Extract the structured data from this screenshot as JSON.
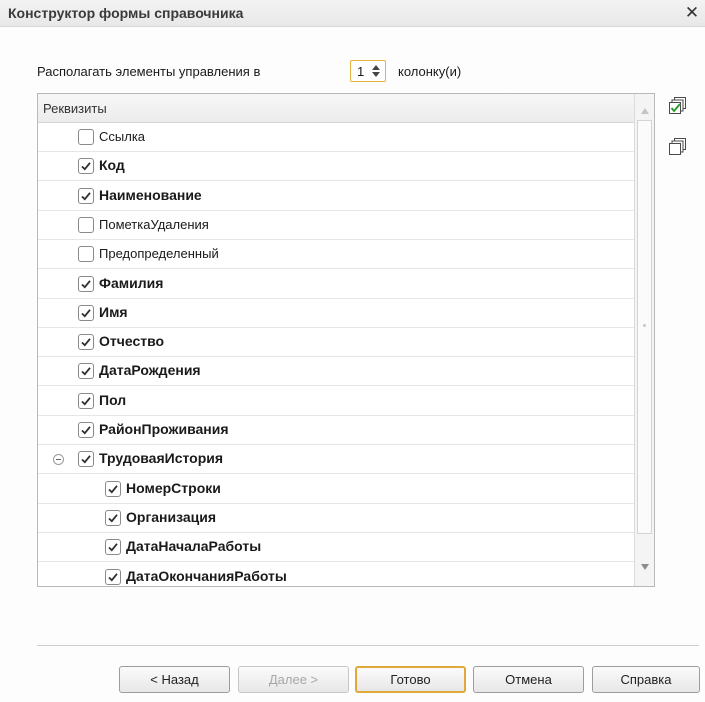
{
  "window": {
    "title": "Конструктор формы справочника",
    "close_glyph": "✕"
  },
  "columns_setting": {
    "label": "Располагать элементы управления в",
    "value": "1",
    "suffix": "колонку(и)"
  },
  "tree": {
    "header": "Реквизиты",
    "rows": [
      {
        "label": "Ссылка",
        "checked": false,
        "bold": false,
        "level": 0
      },
      {
        "label": "Код",
        "checked": true,
        "bold": true,
        "level": 0
      },
      {
        "label": "Наименование",
        "checked": true,
        "bold": true,
        "level": 0
      },
      {
        "label": "ПометкаУдаления",
        "checked": false,
        "bold": false,
        "level": 0
      },
      {
        "label": "Предопределенный",
        "checked": false,
        "bold": false,
        "level": 0
      },
      {
        "label": "Фамилия",
        "checked": true,
        "bold": true,
        "level": 0
      },
      {
        "label": "Имя",
        "checked": true,
        "bold": true,
        "level": 0
      },
      {
        "label": "Отчество",
        "checked": true,
        "bold": true,
        "level": 0
      },
      {
        "label": "ДатаРождения",
        "checked": true,
        "bold": true,
        "level": 0
      },
      {
        "label": "Пол",
        "checked": true,
        "bold": true,
        "level": 0
      },
      {
        "label": "РайонПроживания",
        "checked": true,
        "bold": true,
        "level": 0
      },
      {
        "label": "ТрудоваяИстория",
        "checked": true,
        "bold": true,
        "level": 0,
        "expanded": true
      },
      {
        "label": "НомерСтроки",
        "checked": true,
        "bold": true,
        "level": 1
      },
      {
        "label": "Организация",
        "checked": true,
        "bold": true,
        "level": 1
      },
      {
        "label": "ДатаНачалаРаботы",
        "checked": true,
        "bold": true,
        "level": 1
      },
      {
        "label": "ДатаОкончанияРаботы",
        "checked": true,
        "bold": true,
        "level": 1
      }
    ]
  },
  "side_icons": [
    "check-all-icon",
    "uncheck-all-icon"
  ],
  "buttons": {
    "back": "< Назад",
    "next": "Далее >",
    "done": "Готово",
    "cancel": "Отмена",
    "help": "Справка"
  },
  "colors": {
    "accent": "#e0a93a",
    "check": "#2f2f2f"
  }
}
